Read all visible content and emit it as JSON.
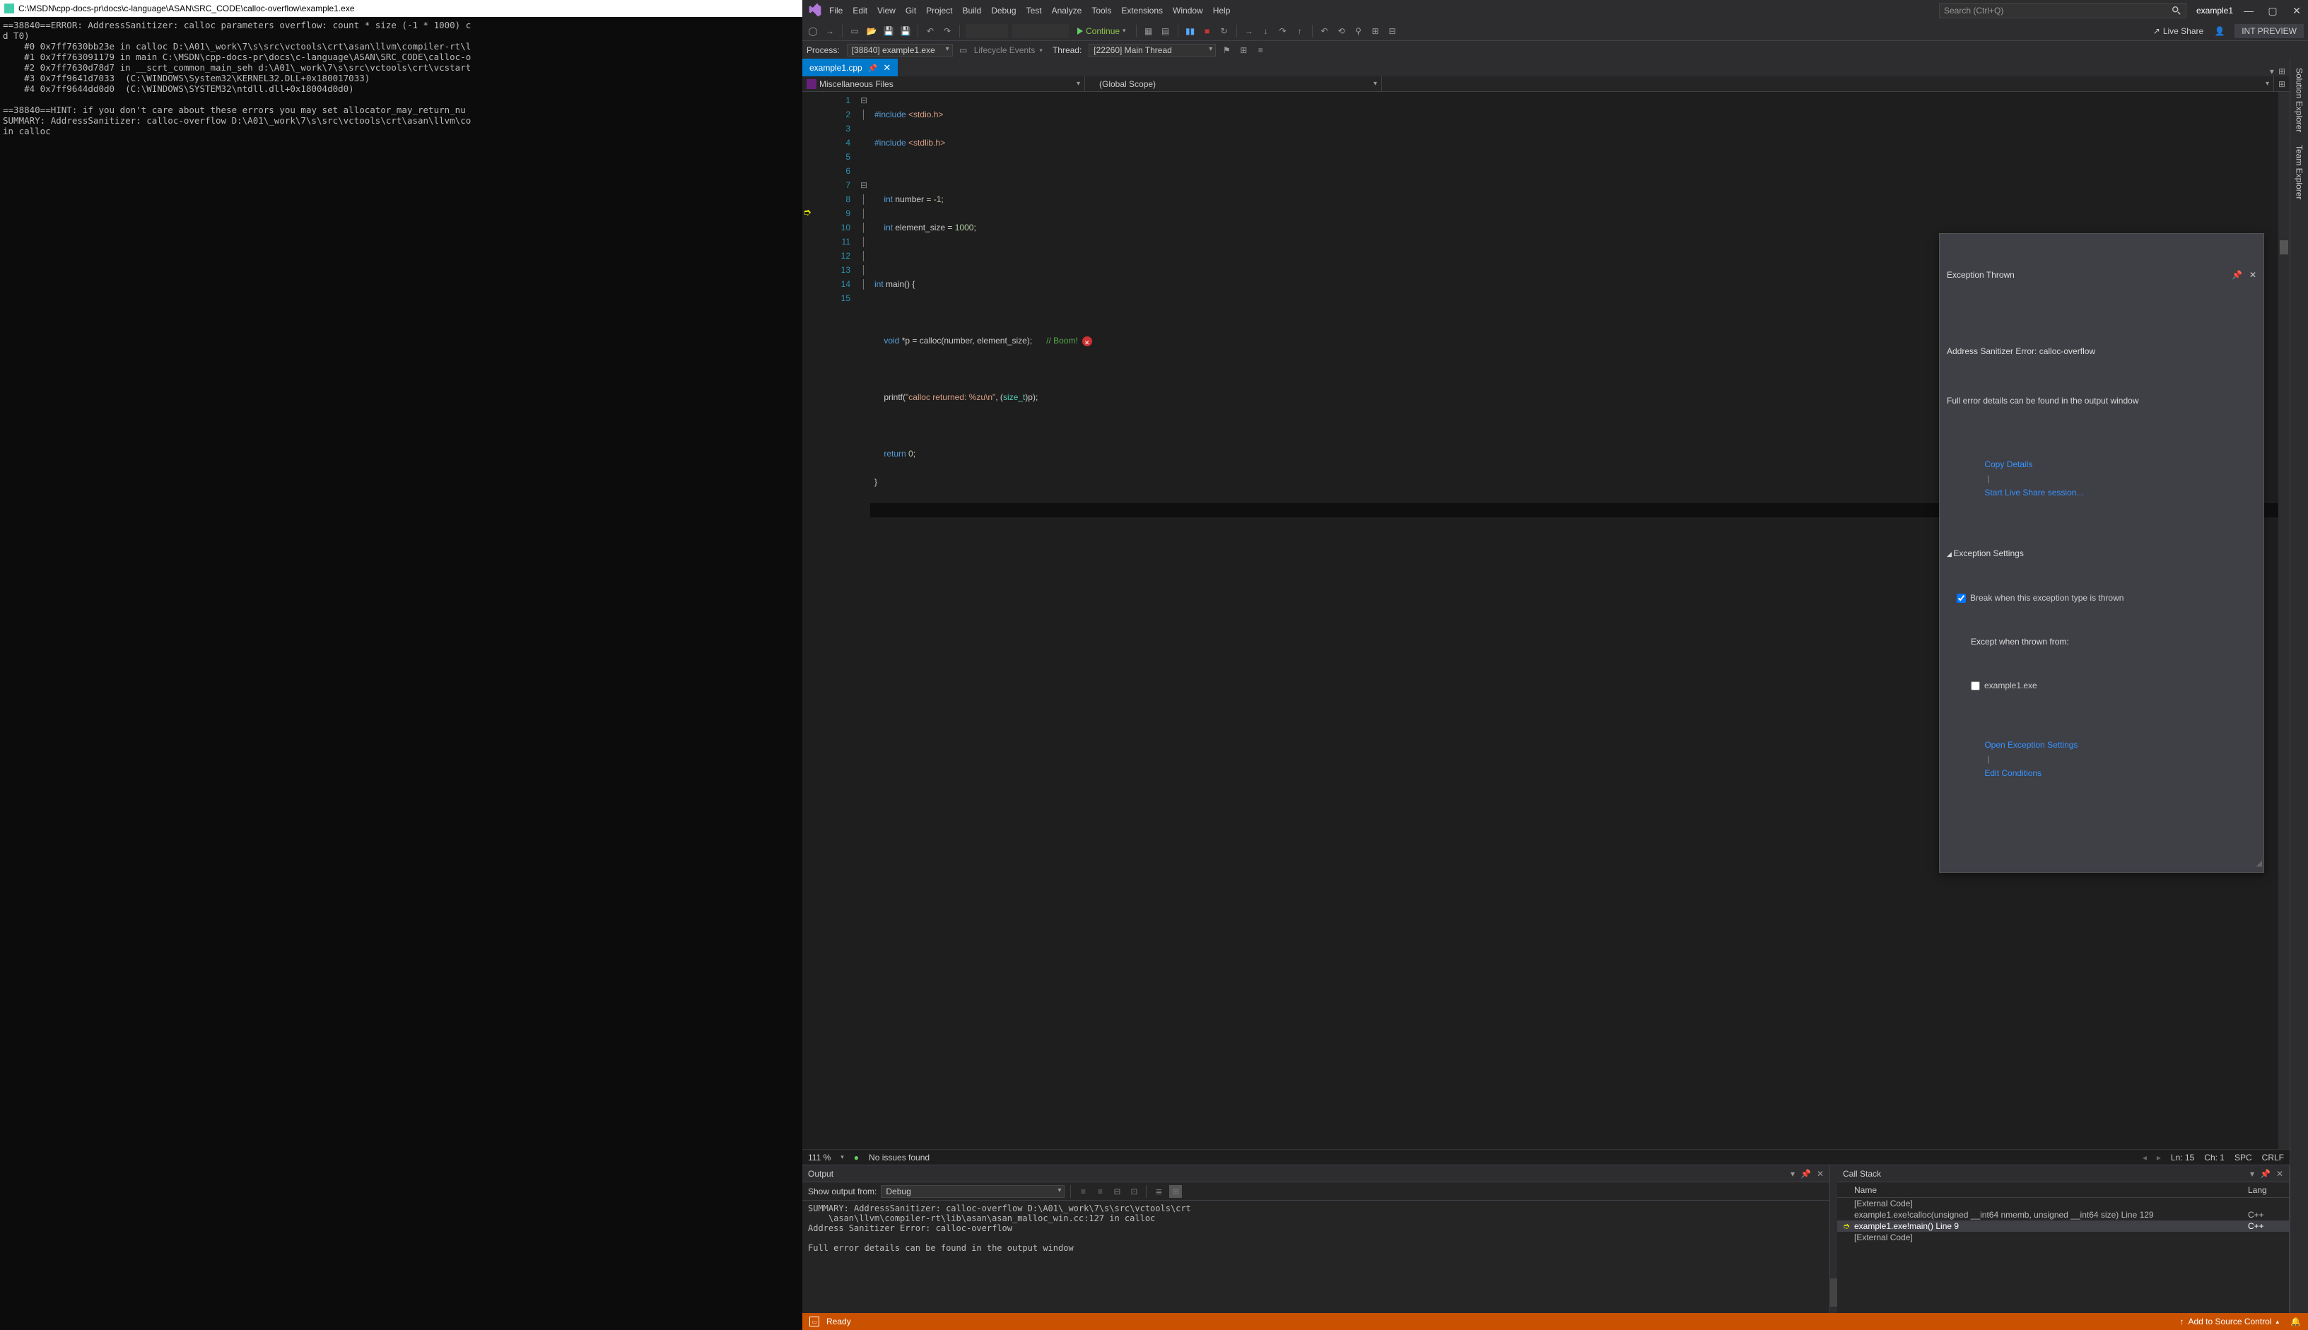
{
  "console": {
    "title": "C:\\MSDN\\cpp-docs-pr\\docs\\c-language\\ASAN\\SRC_CODE\\calloc-overflow\\example1.exe",
    "body": "==38840==ERROR: AddressSanitizer: calloc parameters overflow: count * size (-1 * 1000) c\nd T0)\n    #0 0x7ff7630bb23e in calloc D:\\A01\\_work\\7\\s\\src\\vctools\\crt\\asan\\llvm\\compiler-rt\\l\n    #1 0x7ff763091179 in main C:\\MSDN\\cpp-docs-pr\\docs\\c-language\\ASAN\\SRC_CODE\\calloc-o\n    #2 0x7ff7630d78d7 in __scrt_common_main_seh d:\\A01\\_work\\7\\s\\src\\vctools\\crt\\vcstart\n    #3 0x7ff9641d7033  (C:\\WINDOWS\\System32\\KERNEL32.DLL+0x180017033)\n    #4 0x7ff9644dd0d0  (C:\\WINDOWS\\SYSTEM32\\ntdll.dll+0x18004d0d0)\n\n==38840==HINT: if you don't care about these errors you may set allocator_may_return_nu\nSUMMARY: AddressSanitizer: calloc-overflow D:\\A01\\_work\\7\\s\\src\\vctools\\crt\\asan\\llvm\\co\nin calloc"
  },
  "vs": {
    "menu": [
      "File",
      "Edit",
      "View",
      "Git",
      "Project",
      "Build",
      "Debug",
      "Test",
      "Analyze",
      "Tools",
      "Extensions",
      "Window",
      "Help"
    ],
    "search_placeholder": "Search (Ctrl+Q)",
    "app_name": "example1",
    "continue_label": "Continue",
    "liveshare_label": "Live Share",
    "intpreview": "INT PREVIEW",
    "process_label": "Process:",
    "process_value": "[38840] example1.exe",
    "lifecycle_label": "Lifecycle Events",
    "thread_label": "Thread:",
    "thread_value": "[22260] Main Thread",
    "tab_name": "example1.cpp",
    "nav_left": "Miscellaneous Files",
    "nav_right": "(Global Scope)",
    "code": {
      "lines": [
        "1",
        "2",
        "3",
        "4",
        "5",
        "6",
        "7",
        "8",
        "9",
        "10",
        "11",
        "12",
        "13",
        "14",
        "15"
      ],
      "l1_a": "#include ",
      "l1_b": "<stdio.h>",
      "l2_a": "#include ",
      "l2_b": "<stdlib.h>",
      "l4": "    int number = -1;",
      "l5": "    int element_size = 1000;",
      "l7": "int main() {",
      "l9_a": "    void *p = calloc(number, element_size);      ",
      "l9_c": "// Boom!",
      "l11_a": "    printf(",
      "l11_b": "\"calloc returned: %zu\\n\"",
      "l11_c": ", (",
      "l11_d": "size_t",
      "l11_e": ")p);",
      "l13": "    return 0;",
      "l14": "}"
    },
    "strip": {
      "zoom": "111 %",
      "issues": "No issues found",
      "ln": "Ln: 15",
      "ch": "Ch: 1",
      "spc": "SPC",
      "crlf": "CRLF"
    },
    "exception": {
      "title": "Exception Thrown",
      "msg1": "Address Sanitizer Error: calloc-overflow",
      "msg2": "Full error details can be found in the output window",
      "copy": "Copy Details",
      "liveshare": "Start Live Share session...",
      "settings": "Exception Settings",
      "break_label": "Break when this exception type is thrown",
      "except_label": "Except when thrown from:",
      "except_item": "example1.exe",
      "open_settings": "Open Exception Settings",
      "edit_cond": "Edit Conditions"
    },
    "output": {
      "title": "Output",
      "show_from": "Show output from:",
      "show_value": "Debug",
      "body": "SUMMARY: AddressSanitizer: calloc-overflow D:\\A01\\_work\\7\\s\\src\\vctools\\crt\n    \\asan\\llvm\\compiler-rt\\lib\\asan\\asan_malloc_win.cc:127 in calloc\nAddress Sanitizer Error: calloc-overflow\n\nFull error details can be found in the output window"
    },
    "callstack": {
      "title": "Call Stack",
      "col_name": "Name",
      "col_lang": "Lang",
      "rows": [
        {
          "name": "[External Code]",
          "lang": ""
        },
        {
          "name": "example1.exe!calloc(unsigned __int64 nmemb, unsigned __int64 size) Line 129",
          "lang": "C++"
        },
        {
          "name": "example1.exe!main() Line 9",
          "lang": "C++"
        },
        {
          "name": "[External Code]",
          "lang": ""
        }
      ]
    },
    "status": {
      "ready": "Ready",
      "source_control": "Add to Source Control"
    },
    "side_tabs": [
      "Solution Explorer",
      "Team Explorer"
    ]
  }
}
